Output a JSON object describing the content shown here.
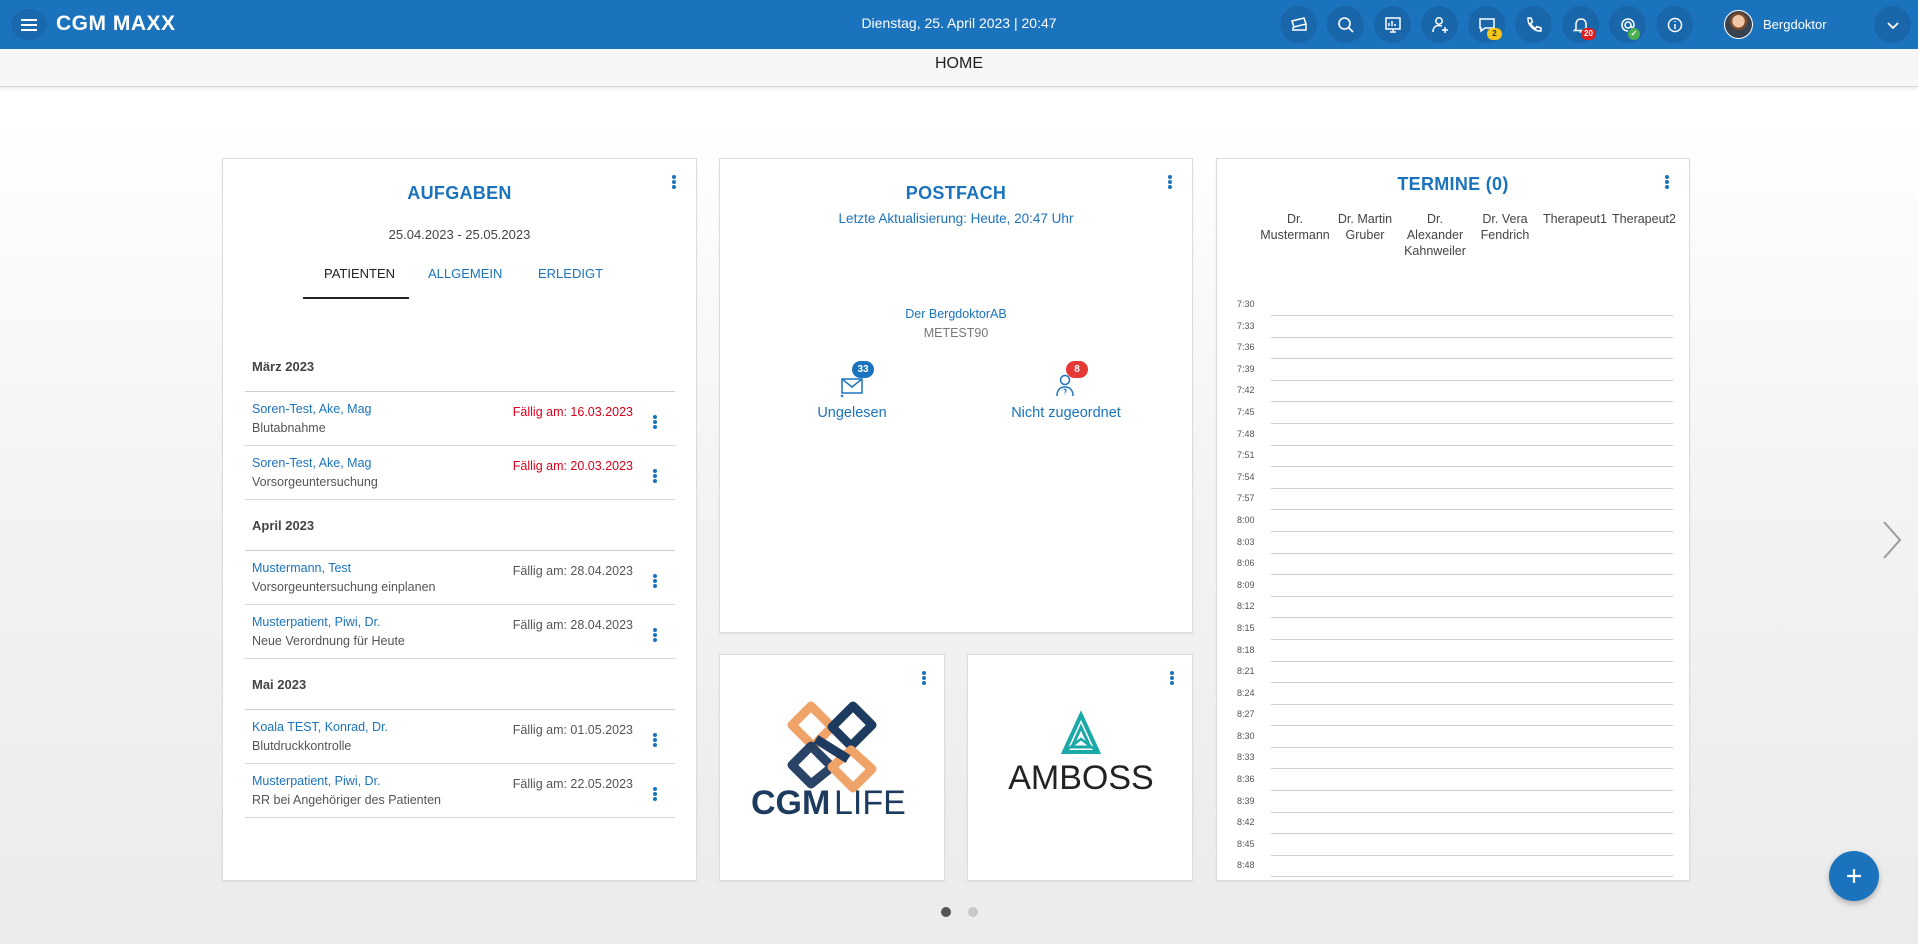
{
  "app": {
    "title": "CGM MAXX",
    "datetime": "Dienstag, 25. April 2023 | 20:47",
    "brand_color": "#1b73be"
  },
  "toolbar": {
    "icons": [
      {
        "name": "ticket-icon"
      },
      {
        "name": "search-icon"
      },
      {
        "name": "monitor-icon"
      },
      {
        "name": "add-patient-icon"
      },
      {
        "name": "chat-icon",
        "badge": "2",
        "badge_color": "#f5c518"
      },
      {
        "name": "phone-icon"
      },
      {
        "name": "bell-icon",
        "badge": "20",
        "badge_color": "#e02020"
      },
      {
        "name": "at-icon",
        "badge": "✓",
        "badge_color": "#4caf50"
      },
      {
        "name": "info-icon"
      }
    ],
    "user_name": "Bergdoktor"
  },
  "page": {
    "title": "HOME"
  },
  "aufgaben": {
    "title": "AUFGABEN",
    "date_range": "25.04.2023 - 25.05.2023",
    "tabs": [
      "PATIENTEN",
      "ALLGEMEIN",
      "ERLEDIGT"
    ],
    "active_tab": "PATIENTEN",
    "groups": [
      {
        "month": "März  2023",
        "tasks": [
          {
            "patient": "Soren-Test, Ake, Mag",
            "desc": "Blutabnahme",
            "due": "Fällig am: 16.03.2023",
            "overdue": true
          },
          {
            "patient": "Soren-Test, Ake, Mag",
            "desc": "Vorsorgeuntersuchung",
            "due": "Fällig am: 20.03.2023",
            "overdue": true
          }
        ]
      },
      {
        "month": "April  2023",
        "tasks": [
          {
            "patient": "Mustermann, Test",
            "desc": "Vorsorgeuntersuchung einplanen",
            "due": "Fällig am: 28.04.2023",
            "overdue": false
          },
          {
            "patient": "Musterpatient, Piwi, Dr.",
            "desc": "Neue Verordnung für Heute",
            "due": "Fällig am: 28.04.2023",
            "overdue": false
          }
        ]
      },
      {
        "month": "Mai  2023",
        "tasks": [
          {
            "patient": "Koala TEST, Konrad, Dr.",
            "desc": "Blutdruckkontrolle",
            "due": "Fällig am: 01.05.2023",
            "overdue": false
          },
          {
            "patient": "Musterpatient, Piwi, Dr.",
            "desc": "RR bei Angehöriger des Patienten",
            "due": "Fällig am: 22.05.2023",
            "overdue": false
          }
        ]
      }
    ]
  },
  "postfach": {
    "title": "POSTFACH",
    "last_update": "Letzte Aktualisierung: Heute, 20:47 Uhr",
    "mailbox_name": "Der BergdoktorAB",
    "mailbox_id": "METEST90",
    "unread_label": "Ungelesen",
    "unread_count": "33",
    "unassigned_label": "Nicht zugeordnet",
    "unassigned_count": "8"
  },
  "tiles": {
    "cgm_life": {
      "text_a": "CGM",
      "text_b": "LIFE"
    },
    "amboss": {
      "text": "AMBOSS"
    }
  },
  "termine": {
    "title": "TERMINE (0)",
    "columns": [
      "Dr.\nMustermann",
      "Dr. Martin\nGruber",
      "Dr.\nAlexander\nKahnweiler",
      "Dr. Vera\nFendrich",
      "Therapeut1",
      "Therapeut2"
    ],
    "times": [
      "7:30",
      "7:33",
      "7:36",
      "7:39",
      "7:42",
      "7:45",
      "7:48",
      "7:51",
      "7:54",
      "7:57",
      "8:00",
      "8:03",
      "8:06",
      "8:09",
      "8:12",
      "8:15",
      "8:18",
      "8:21",
      "8:24",
      "8:27",
      "8:30",
      "8:33",
      "8:36",
      "8:39",
      "8:42",
      "8:45",
      "8:48"
    ]
  },
  "pager": {
    "page_count": 2,
    "active_index": 0
  }
}
